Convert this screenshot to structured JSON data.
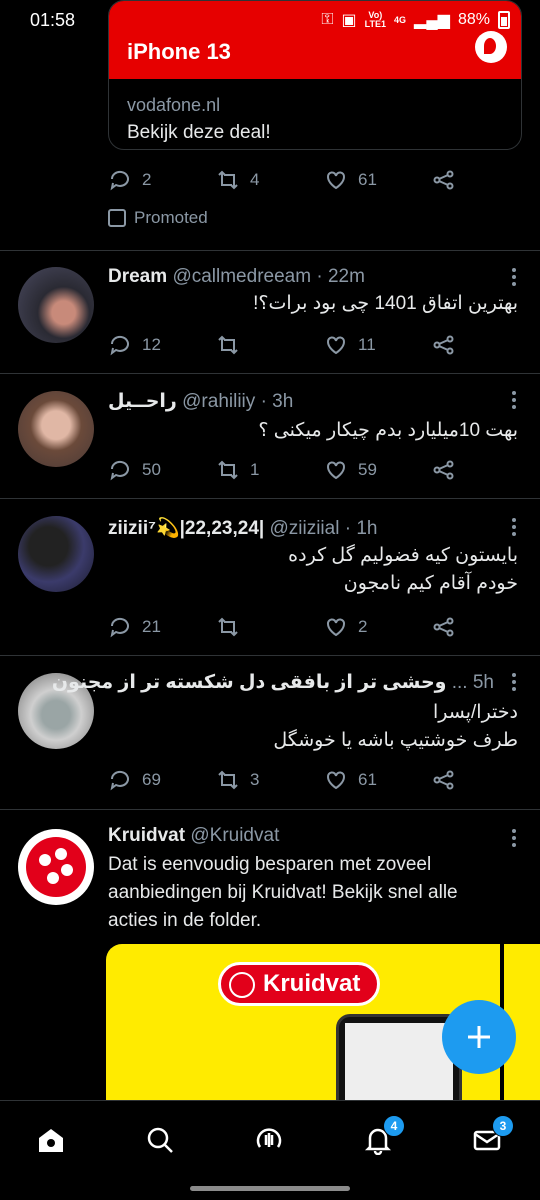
{
  "status": {
    "time": "01:58",
    "network_top": "Vo)",
    "network_bottom": "LTE1",
    "gen": "4G",
    "battery": "88%"
  },
  "promo": {
    "title": "iPhone 13",
    "domain": "vodafone.nl",
    "cta": "Bekijk deze deal!",
    "replies": "2",
    "retweets": "4",
    "likes": "61",
    "label": "Promoted"
  },
  "tweets": [
    {
      "name": "Dream",
      "handle": "@callmedreeam",
      "time": "· 22m",
      "text": "بهترین اتفاق 1401 چی بود برات؟!",
      "replies": "12",
      "retweets": "",
      "likes": "11"
    },
    {
      "name": "راحــیل",
      "handle": "@rahiliiy",
      "time": "· 3h",
      "text": "بهت 10میلیارد بدم چیکار میکنی ؟",
      "replies": "50",
      "retweets": "1",
      "likes": "59"
    },
    {
      "name": "ziizii⁷💫|22,23,24|",
      "handle": "@ziiziial",
      "time": "· 1h",
      "text_line1": "بایستون کیه فضولیم گل کرده",
      "text_line2": "خودم آقام کیم نامجون",
      "replies": "21",
      "retweets": "",
      "likes": "2"
    },
    {
      "name": "وحشی تر از بافقی دل شکسته تر از مجنون",
      "handle": "...",
      "time": "5h",
      "text_line1": "دخترا/پسرا",
      "text_line2": "طرف خوشتیپ باشه یا خوشگل",
      "replies": "69",
      "retweets": "3",
      "likes": "61"
    },
    {
      "name": "Kruidvat",
      "handle": "@Kruidvat",
      "text": "Dat is eenvoudig besparen met zoveel aanbiedingen bij Kruidvat! Bekijk snel alle acties in de folder.",
      "logo_text": "Kruidvat"
    }
  ],
  "nav": {
    "notifications_badge": "4",
    "messages_badge": "3"
  },
  "colors": {
    "accent": "#1d9bf0",
    "promo_red": "#e60000",
    "kruidvat_red": "#e2001a",
    "ad_yellow": "#ffeb00"
  }
}
